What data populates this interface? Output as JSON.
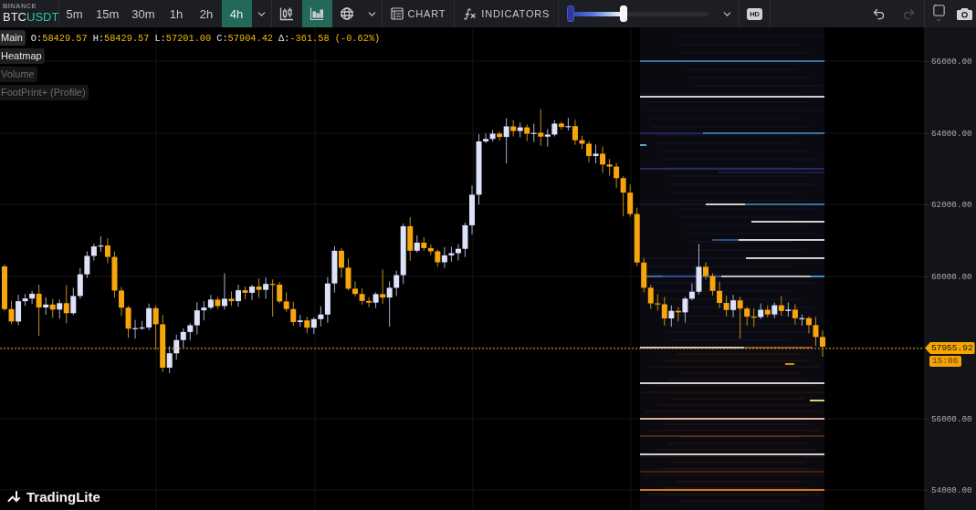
{
  "toolbar": {
    "symbol": {
      "exchange": "BINANCE",
      "base": "BTC",
      "quote": "USDT"
    },
    "intervals": [
      {
        "label": "5m",
        "selected": false
      },
      {
        "label": "15m",
        "selected": false
      },
      {
        "label": "30m",
        "selected": false
      },
      {
        "label": "1h",
        "selected": false
      },
      {
        "label": "2h",
        "selected": false
      },
      {
        "label": "4h",
        "selected": true
      }
    ],
    "chart_modes": [
      {
        "kind": "candles",
        "selected": false
      },
      {
        "kind": "filled-candles",
        "selected": true
      },
      {
        "kind": "heatmap",
        "selected": false
      }
    ],
    "chart_button": "CHART",
    "indicators_button": "INDICATORS",
    "range_slider": {
      "level": 0.4
    },
    "hd_badge": "HD",
    "history": [
      {
        "kind": "undo",
        "disabled": false
      },
      {
        "kind": "redo",
        "disabled": true
      }
    ]
  },
  "legend": {
    "main": "Main",
    "ohlc": [
      {
        "key": "O:",
        "value": "58429.57"
      },
      {
        "key": "H:",
        "value": "58429.57"
      },
      {
        "key": "L:",
        "value": "57201.00"
      },
      {
        "key": "C:",
        "value": "57904.42"
      },
      {
        "key": "Δ:",
        "value": "-361.58 (-0.62%)"
      }
    ],
    "layers": [
      {
        "label": "Heatmap",
        "visible": true
      },
      {
        "label": "Volume",
        "visible": false
      },
      {
        "label": "FootPrint+ (Profile)",
        "visible": false
      }
    ]
  },
  "price_axis": {
    "labels": [
      "66000.00",
      "64000.00",
      "62000.00",
      "60000.00",
      "56000.00",
      "54000.00"
    ],
    "last_price": "57955.92",
    "countdown": "15:06"
  },
  "logo": "TradingLite"
}
